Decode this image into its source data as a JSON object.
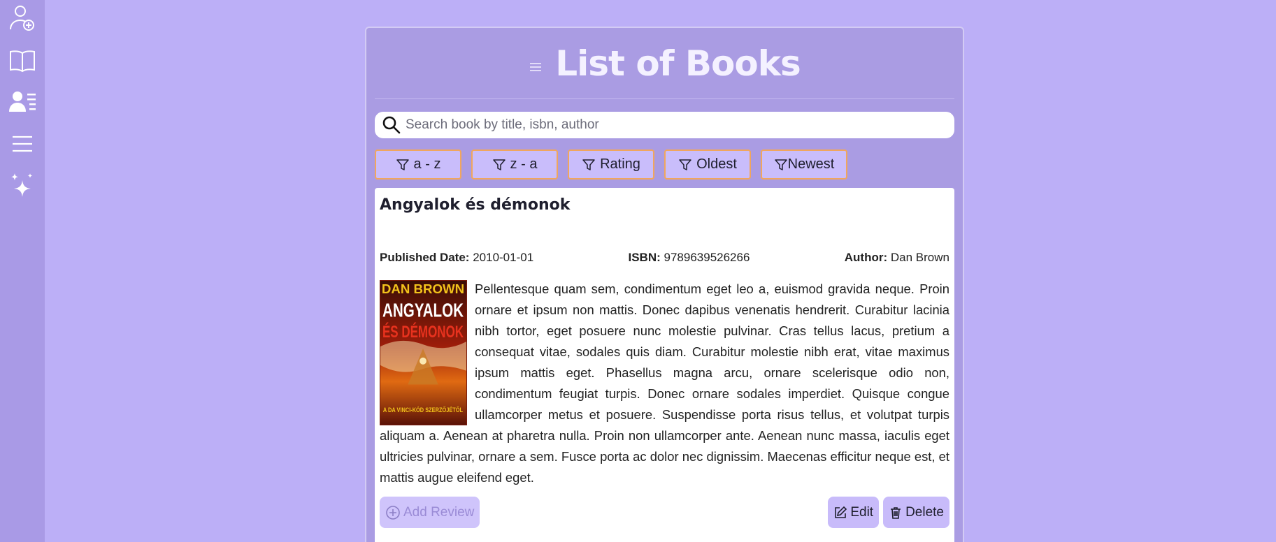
{
  "sidebar": {
    "items": [
      {
        "icon": "add-user-icon"
      },
      {
        "icon": "book-open-icon"
      },
      {
        "icon": "user-list-icon"
      },
      {
        "icon": "hamburger-menu-icon"
      },
      {
        "icon": "sparkles-icon"
      }
    ]
  },
  "header": {
    "menu_icon": "hamburger-menu-icon",
    "title": "List of Books"
  },
  "search": {
    "placeholder": "Search book by title, isbn, author",
    "value": ""
  },
  "filters": [
    {
      "label": "a - z",
      "icon": "funnel-icon"
    },
    {
      "label": "z - a",
      "icon": "funnel-icon"
    },
    {
      "label": "Rating",
      "icon": "funnel-icon"
    },
    {
      "label": "Oldest",
      "icon": "funnel-icon"
    },
    {
      "label": "Newest",
      "icon": "funnel-icon"
    }
  ],
  "book": {
    "title": "Angyalok és démonok",
    "published_label": "Published Date:",
    "published_value": "2010-01-01",
    "isbn_label": "ISBN:",
    "isbn_value": "9789639526266",
    "author_label": "Author:",
    "author_value": "Dan Brown",
    "cover": {
      "author_text": "DAN BROWN",
      "title_line1": "ANGYALOK",
      "title_line2": "ÉS DÉMONOK",
      "tagline": "A DA VINCI-KÓD SZERZŐJÉTŐL"
    },
    "description": "Pellentesque quam sem, condimentum eget leo a, euismod gravida neque. Proin ornare et ipsum non mattis. Donec dapibus venenatis hendrerit. Curabitur lacinia nibh tortor, eget posuere nunc molestie pulvinar. Cras tellus lacus, pretium a consequat vitae, sodales quis diam. Curabitur molestie nibh erat, vitae maximus ipsum mattis eget. Phasellus magna arcu, ornare scelerisque odio non, condimentum feugiat turpis. Donec ornare sodales imperdiet. Quisque congue ullamcorper metus et posuere. Suspendisse porta risus tellus, et volutpat turpis aliquam a. Aenean at pharetra nulla. Proin non ullamcorper ante. Aenean nunc massa, iaculis eget ultricies pulvinar, ornare a sem. Fusce porta ac dolor nec dignissim. Maecenas efficitur neque est, et mattis augue eleifend eget.",
    "add_review_label": "Add Review",
    "edit_label": "Edit",
    "delete_label": "Delete"
  }
}
